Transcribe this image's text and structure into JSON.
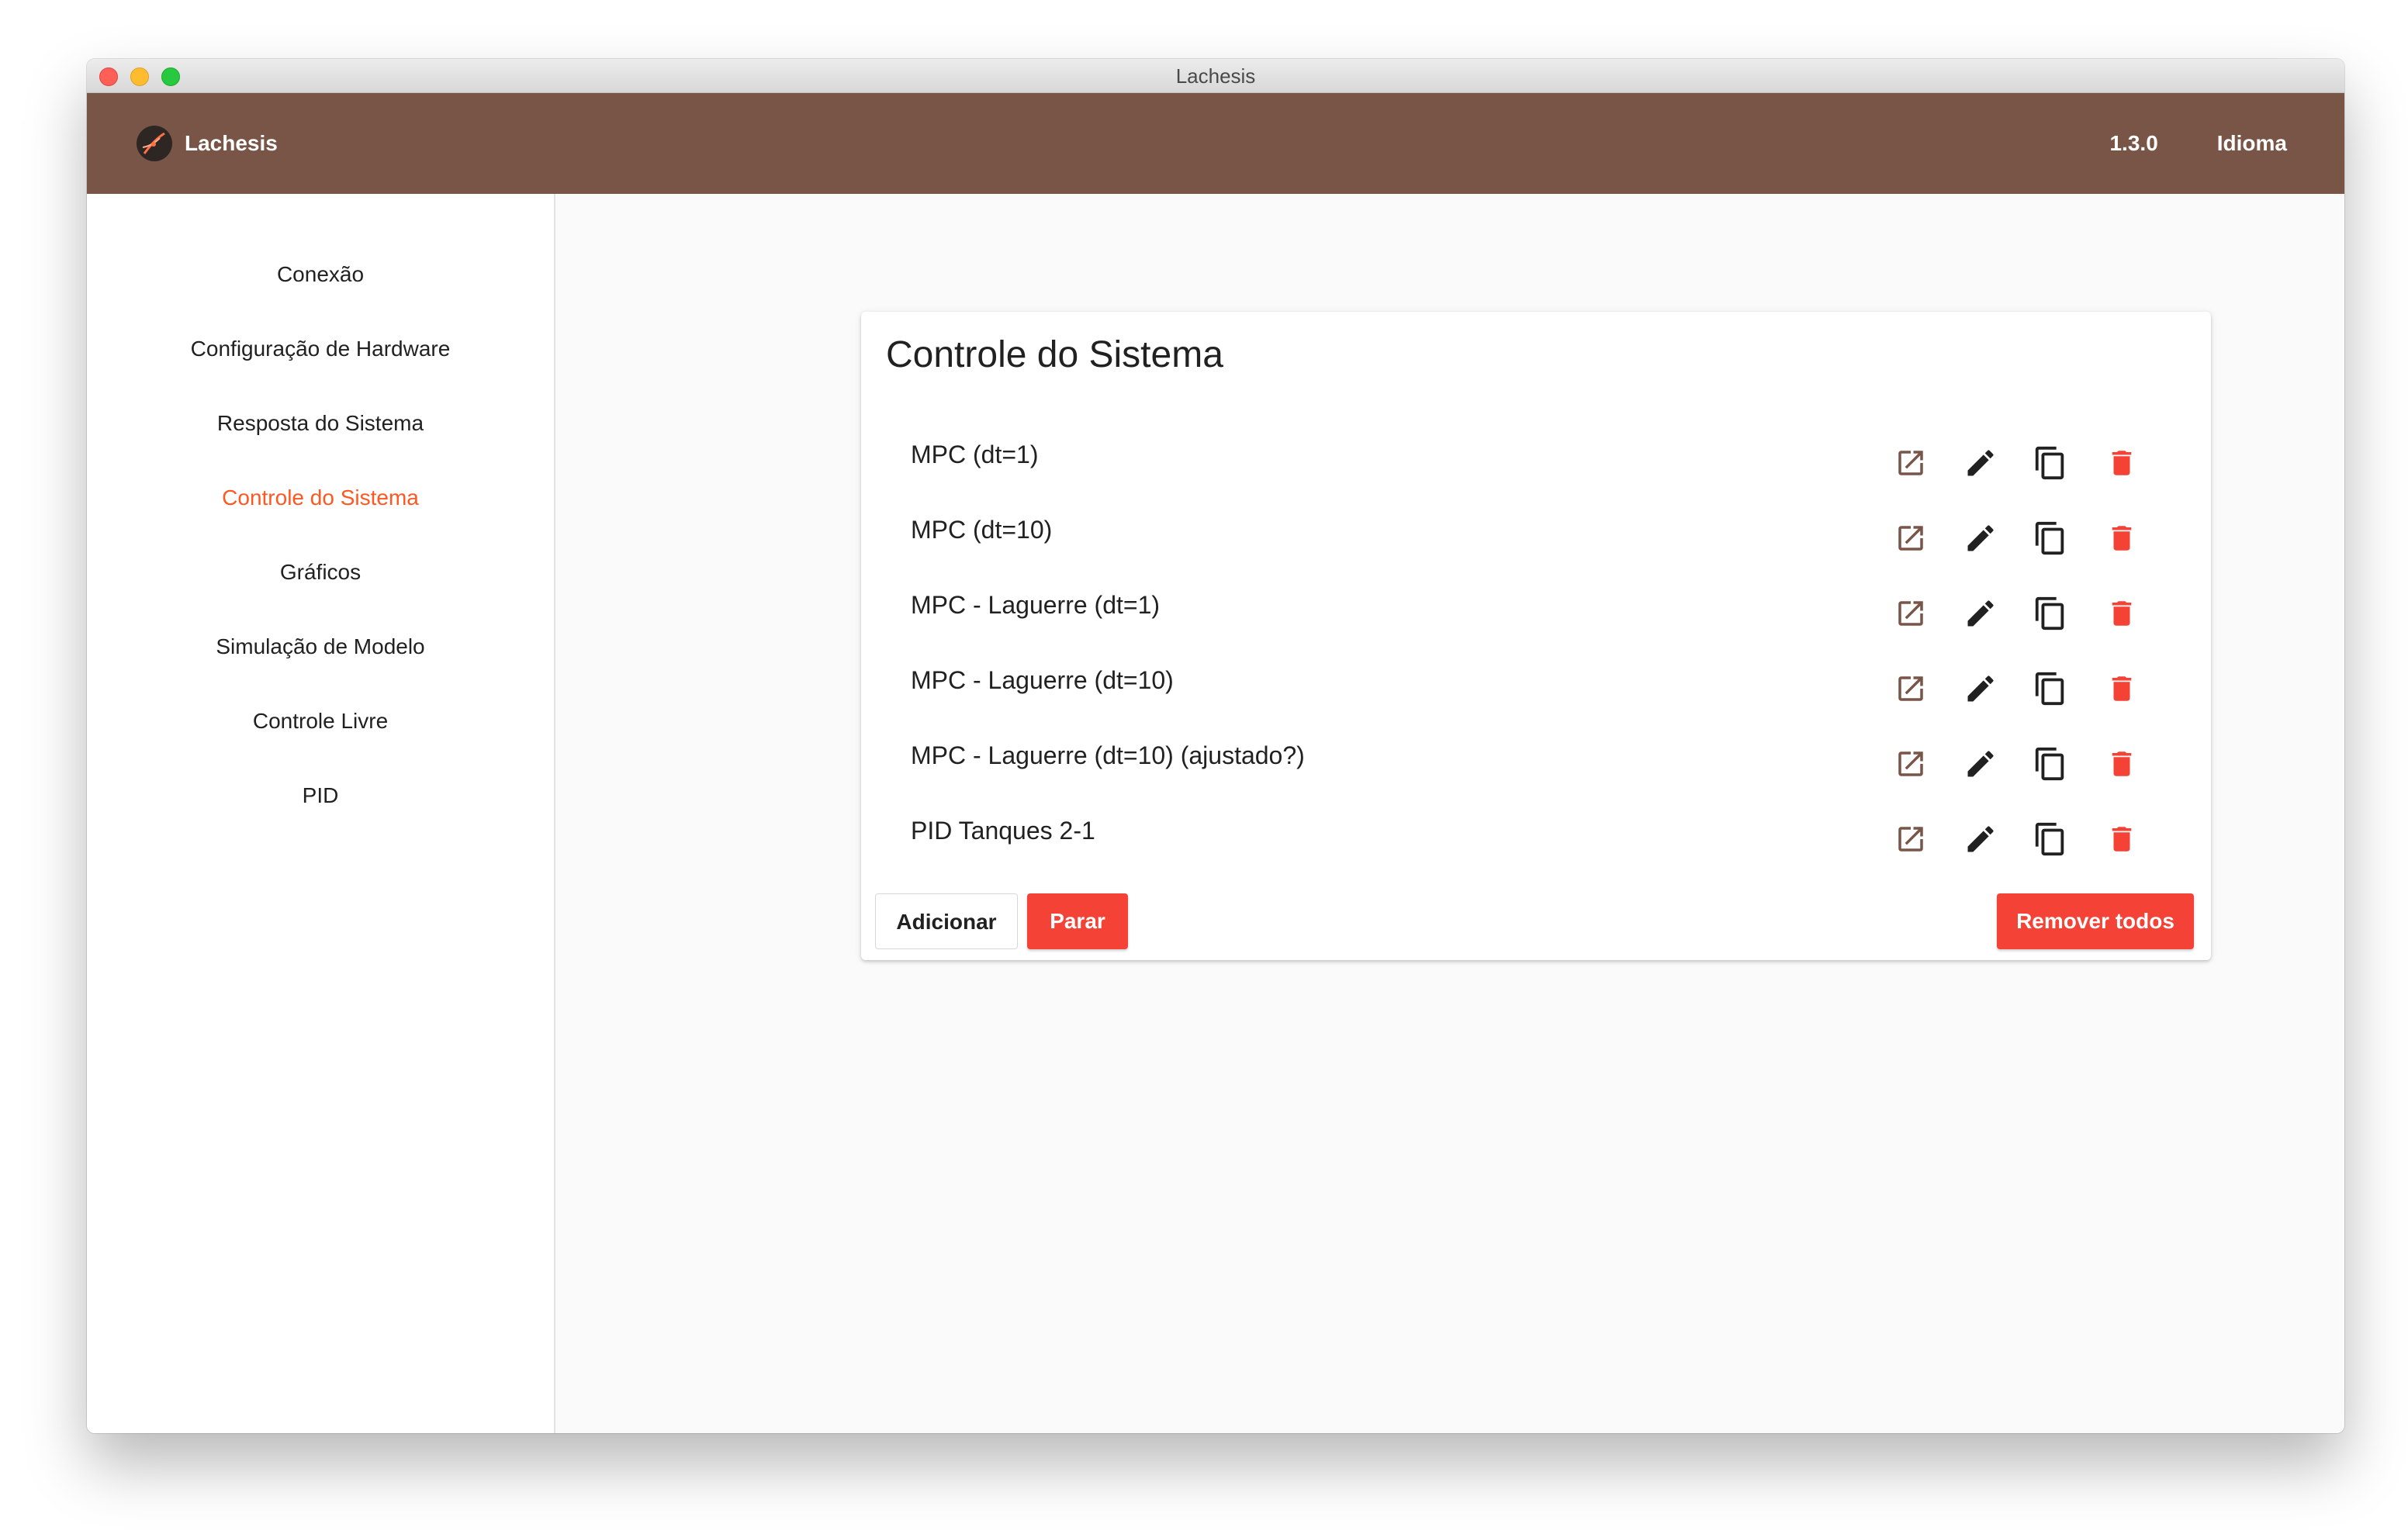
{
  "window": {
    "title": "Lachesis"
  },
  "appbar": {
    "brand": "Lachesis",
    "version": "1.3.0",
    "language": "Idioma"
  },
  "sidebar": {
    "items": [
      {
        "label": "Conexão"
      },
      {
        "label": "Configuração de Hardware"
      },
      {
        "label": "Resposta do Sistema"
      },
      {
        "label": "Controle do Sistema",
        "active": true
      },
      {
        "label": "Gráficos"
      },
      {
        "label": "Simulação de Modelo"
      },
      {
        "label": "Controle Livre"
      },
      {
        "label": "PID"
      }
    ]
  },
  "main": {
    "title": "Controle do Sistema",
    "controllers": [
      {
        "name": "MPC (dt=1)"
      },
      {
        "name": "MPC (dt=10)"
      },
      {
        "name": "MPC - Laguerre (dt=1)"
      },
      {
        "name": "MPC - Laguerre (dt=10)"
      },
      {
        "name": "MPC - Laguerre (dt=10) (ajustado?)"
      },
      {
        "name": "PID Tanques 2-1"
      }
    ],
    "row_icons": [
      "open-in-new-icon",
      "edit-pencil-icon",
      "copy-icon",
      "delete-trash-icon"
    ],
    "buttons": {
      "add": "Adicionar",
      "stop": "Parar",
      "remove_all": "Remover todos"
    }
  },
  "colors": {
    "appbar": "#795548",
    "active_nav": "#ff5722",
    "danger": "#f44336",
    "open_icon": "#795548",
    "icon_dark": "#212121"
  }
}
